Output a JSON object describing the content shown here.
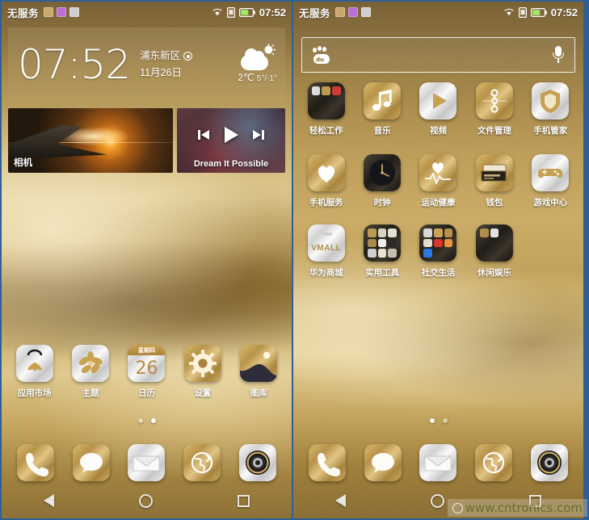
{
  "colors": {
    "gold": "#b8934a",
    "gold_light": "#e3cd93",
    "silver": "#d2d2d2",
    "dark_folder": "#201d16",
    "panel_divider": "#2d6096",
    "accent_text": "#ffffff",
    "watermark_text": "#5d6b2a"
  },
  "status_bar": {
    "carrier": "无服务",
    "time": "07:52",
    "notification_icons": [
      "sd-card-icon",
      "usb-debug-icon",
      "alarm-icon"
    ],
    "right_icons": [
      "wifi-icon",
      "sim-icon",
      "battery-icon"
    ]
  },
  "left_screen": {
    "clock_widget": {
      "time": "07:52",
      "location": "浦东新区",
      "date": "11月26日",
      "weather_icon": "partly-cloudy-icon",
      "temperature": "2℃",
      "range": "5°/-1°"
    },
    "camera_widget": {
      "label": "相机",
      "icon": "camera-widget-icon"
    },
    "music_widget": {
      "title": "Dream It Possible",
      "controls": [
        "previous-icon",
        "play-icon",
        "next-icon"
      ]
    },
    "apps": [
      {
        "label": "应用市场",
        "icon": "app-market-icon",
        "style": "silver"
      },
      {
        "label": "主题",
        "icon": "themes-icon",
        "style": "silver"
      },
      {
        "label": "日历",
        "icon": "calendar-icon",
        "style": "silver",
        "weekday": "星期四",
        "day": "26"
      },
      {
        "label": "设置",
        "icon": "settings-gear-icon",
        "style": "gold"
      },
      {
        "label": "图库",
        "icon": "gallery-icon",
        "style": "gold"
      }
    ],
    "page_dots": {
      "count": 2,
      "active_index": 1
    }
  },
  "right_screen": {
    "search": {
      "logo_icon": "baidu-paw-icon",
      "placeholder": "",
      "value": "",
      "mic_icon": "microphone-icon"
    },
    "apps_row1": [
      {
        "label": "轻松工作",
        "icon": "folder-work-icon",
        "style": "folder"
      },
      {
        "label": "音乐",
        "icon": "music-note-icon",
        "style": "gold"
      },
      {
        "label": "视频",
        "icon": "video-play-icon",
        "style": "silver"
      },
      {
        "label": "文件管理",
        "icon": "file-manager-icon",
        "style": "gold"
      },
      {
        "label": "手机管家",
        "icon": "phone-manager-shield-icon",
        "style": "silver"
      }
    ],
    "apps_row2": [
      {
        "label": "手机服务",
        "icon": "phone-service-heart-icon",
        "style": "gold"
      },
      {
        "label": "时钟",
        "icon": "clock-icon",
        "style": "dark"
      },
      {
        "label": "运动健康",
        "icon": "health-pulse-icon",
        "style": "gold"
      },
      {
        "label": "钱包",
        "icon": "wallet-icon",
        "style": "gold"
      },
      {
        "label": "游戏中心",
        "icon": "game-controller-icon",
        "style": "silver"
      }
    ],
    "apps_row3": [
      {
        "label": "华为商城",
        "icon": "vmall-icon",
        "style": "silver",
        "text": "VMALL"
      },
      {
        "label": "实用工具",
        "icon": "folder-tools-icon",
        "style": "folder"
      },
      {
        "label": "社交生活",
        "icon": "folder-social-icon",
        "style": "folder"
      },
      {
        "label": "休闲娱乐",
        "icon": "folder-entertainment-icon",
        "style": "folder"
      }
    ],
    "page_dots": {
      "count": 2,
      "active_index": 0
    }
  },
  "dock": [
    {
      "label": "电话",
      "icon": "phone-icon",
      "style": "gold"
    },
    {
      "label": "信息",
      "icon": "message-icon",
      "style": "gold"
    },
    {
      "label": "邮件",
      "icon": "email-icon",
      "style": "silver"
    },
    {
      "label": "浏览器",
      "icon": "browser-globe-icon",
      "style": "gold"
    },
    {
      "label": "相机",
      "icon": "camera-lens-icon",
      "style": "silver"
    }
  ],
  "nav_bar": {
    "back": "back-icon",
    "home": "home-icon",
    "recents": "recents-icon"
  },
  "watermark": {
    "text": "www.cntronics.com"
  }
}
